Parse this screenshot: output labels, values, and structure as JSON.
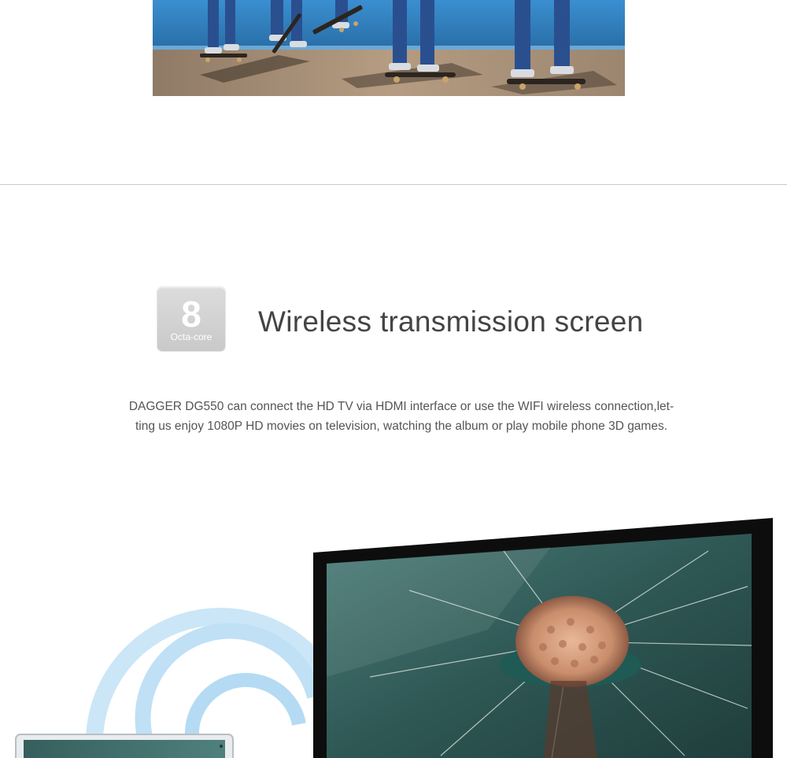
{
  "badge": {
    "number": "8",
    "caption": "Octa-core"
  },
  "section": {
    "title": "Wireless transmission screen",
    "description_lines": [
      "DAGGER DG550 can connect the HD TV via HDMI interface or use the WIFI wireless connection,let-",
      "ting us enjoy 1080P HD movies on television, watching the album or play mobile phone 3D games."
    ]
  },
  "colors": {
    "wall": "#2f7fbf",
    "badge": "#d2d2d2",
    "wifi": "#bfe0f5",
    "tv_frame": "#0d0d0d",
    "screen": "#2f5a55"
  }
}
